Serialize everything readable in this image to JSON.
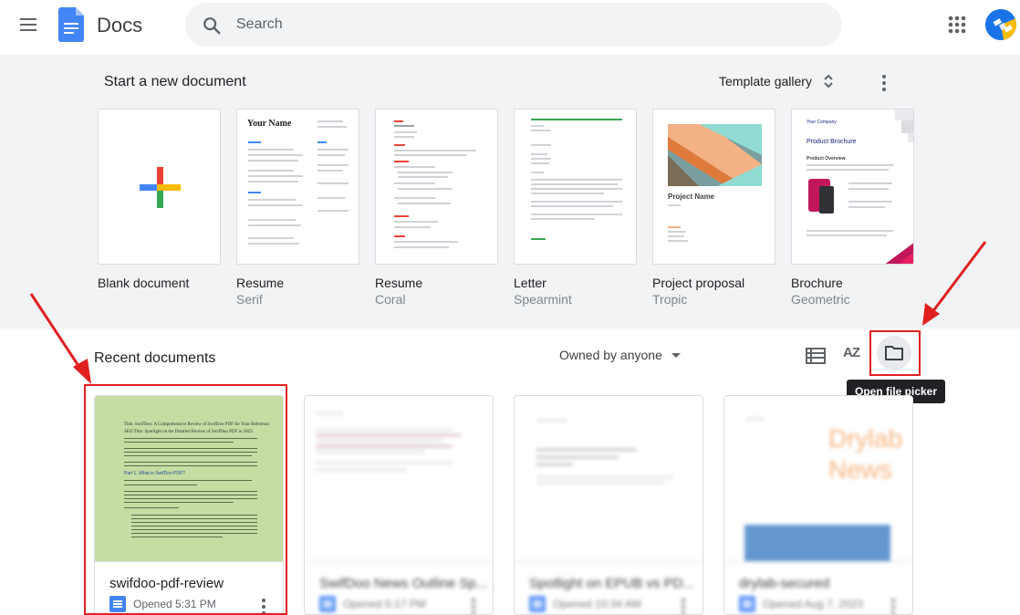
{
  "header": {
    "app_title": "Docs",
    "search_placeholder": "Search",
    "colors": {
      "logo_blue": "#4285f4",
      "search_bg": "#f1f3f4"
    }
  },
  "templates": {
    "heading": "Start a new document",
    "gallery_label": "Template gallery",
    "items": [
      {
        "name": "Blank document",
        "sub": ""
      },
      {
        "name": "Resume",
        "sub": "Serif"
      },
      {
        "name": "Resume",
        "sub": "Coral"
      },
      {
        "name": "Letter",
        "sub": "Spearmint"
      },
      {
        "name": "Project proposal",
        "sub": "Tropic"
      },
      {
        "name": "Brochure",
        "sub": "Geometric"
      }
    ],
    "resume_heading": "Your Name",
    "project_heading": "Project Name",
    "brochure_company": "Your Company",
    "brochure_title": "Product Brochure",
    "brochure_overview": "Product Overview"
  },
  "recent": {
    "heading": "Recent documents",
    "owned_filter": "Owned by anyone",
    "sort_label": "AZ",
    "tooltip": "Open file picker",
    "docs": [
      {
        "title": "swifdoo-pdf-review",
        "opened": "Opened 5:31 PM",
        "thumb_color": "#c5dca3"
      },
      {
        "title": "SwifDoo News Outline Sp...",
        "opened": "Opened 5:17 PM",
        "thumb_color": "#ffffff"
      },
      {
        "title": "Spotlight on EPUB vs PD...",
        "opened": "Opened 10:34 AM",
        "thumb_color": "#ffffff"
      },
      {
        "title": "drylab-secured",
        "opened": "Opened Aug 7, 2023",
        "thumb_color": "#ffffff"
      }
    ],
    "preview_title": "Title: SwifDoo: A Comprehensive Review of SwifDoo PDF for Your Reference",
    "preview_seo": "SEO Title: Spotlight on the Detailed Review of SwifDoo PDF in 2023",
    "preview_section": "Part 1. What is SwifDoo PDF?",
    "drylab_text": "Drylab News"
  }
}
